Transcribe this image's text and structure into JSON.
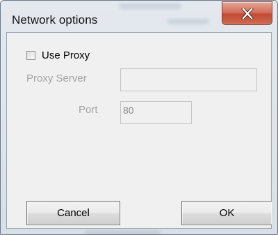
{
  "window": {
    "title": "Network options"
  },
  "titlebar": {
    "close_icon": "close-x-icon"
  },
  "proxy": {
    "use_proxy_label": "Use Proxy",
    "use_proxy_checked": false,
    "server_label": "Proxy Server",
    "server_value": "",
    "port_label": "Port",
    "port_value": "80"
  },
  "buttons": {
    "cancel_label": "Cancel",
    "ok_label": "OK"
  }
}
